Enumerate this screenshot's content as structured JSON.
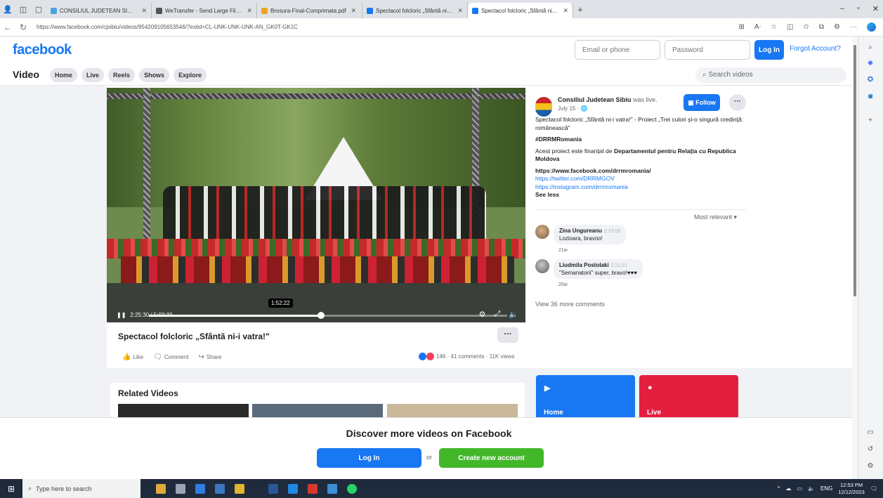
{
  "browser": {
    "tabs": [
      {
        "label": "CONSILIUL JUDETEAN SIBIU - D",
        "color": "#4aa3df",
        "active": false
      },
      {
        "label": "WeTransfer - Send Large Files &",
        "color": "#555555",
        "active": false
      },
      {
        "label": "Brosura-Final-Comprimata.pdf",
        "color": "#f0a020",
        "active": false
      },
      {
        "label": "Spectacol folcloric „Sfântă ni-i va",
        "color": "#1877f2",
        "active": false
      },
      {
        "label": "Spectacol folcloric „Sfântă ni-i va",
        "color": "#1877f2",
        "active": true
      }
    ],
    "url": "https://www.facebook.com/cjsibiu/videos/954209105653546/?extid=CL-UNK-UNK-UNK-AN_GK0T-GK1C"
  },
  "header": {
    "logo": "facebook",
    "email_placeholder": "Email or phone",
    "password_placeholder": "Password",
    "login_label": "Log In",
    "forgot_label": "Forgot Account?"
  },
  "video_nav": {
    "title": "Video",
    "pills": [
      "Home",
      "Live",
      "Reels",
      "Shows",
      "Explore"
    ],
    "search_placeholder": "Search videos"
  },
  "player": {
    "current_time": "2:25:30",
    "total_time": "5:03:33",
    "hover_time": "1:52:22",
    "progress_fraction": 0.48
  },
  "video": {
    "title": "Spectacol folcloric „Sfântă ni-i vatra!\"",
    "more": "···",
    "like_label": "Like",
    "comment_label": "Comment",
    "share_label": "Share",
    "stats": "146 · 41 comments · 11K views"
  },
  "post": {
    "page_name": "Consiliul Judetean Sibiu",
    "was_live": "was live.",
    "date": "July 15 · ",
    "follow_label": "Follow",
    "dots": "···",
    "desc1": "Spectacol folcloric „Sfântă ni-i vatra!\" - Proiect „Trei culori și-o singură credință: românească\"",
    "hashtag": "#DRRMRomania",
    "desc2_pre": "Acest proiect este finanțat de ",
    "desc2_bold": "Departamentul pentru Relația cu Republica Moldova",
    "link1": "https://www.facebook.com/drrmromania/",
    "link2": "https://twitter.com/DRRMGOV",
    "link3": "https://instagram.com/drrmromania",
    "see_less": "See less",
    "sort": "Most relevant ▾",
    "comments": [
      {
        "name": "Zina Ungureanu",
        "time": "2:23:09",
        "text": "Lozioara, bravoo!",
        "ago": "21w"
      },
      {
        "name": "Liudmila Postolaki",
        "time": "2:21:21",
        "text": "\"Semanatorii\" super, bravo!♥♥♥",
        "ago": "20w"
      }
    ],
    "view_more": "View 36 more comments"
  },
  "related": {
    "title": "Related Videos"
  },
  "tiles": [
    {
      "label": "Home",
      "icon": "▶",
      "color": "#1877f2"
    },
    {
      "label": "Live",
      "icon": "●",
      "color": "#e41e3f"
    }
  ],
  "discover": {
    "title": "Discover more videos on Facebook",
    "login_label": "Log In",
    "or_label": "or",
    "create_label": "Create new account"
  },
  "taskbar": {
    "search_placeholder": "Type here to search",
    "lang": "ENG",
    "time": "12:53 PM",
    "date": "12/12/2023"
  }
}
